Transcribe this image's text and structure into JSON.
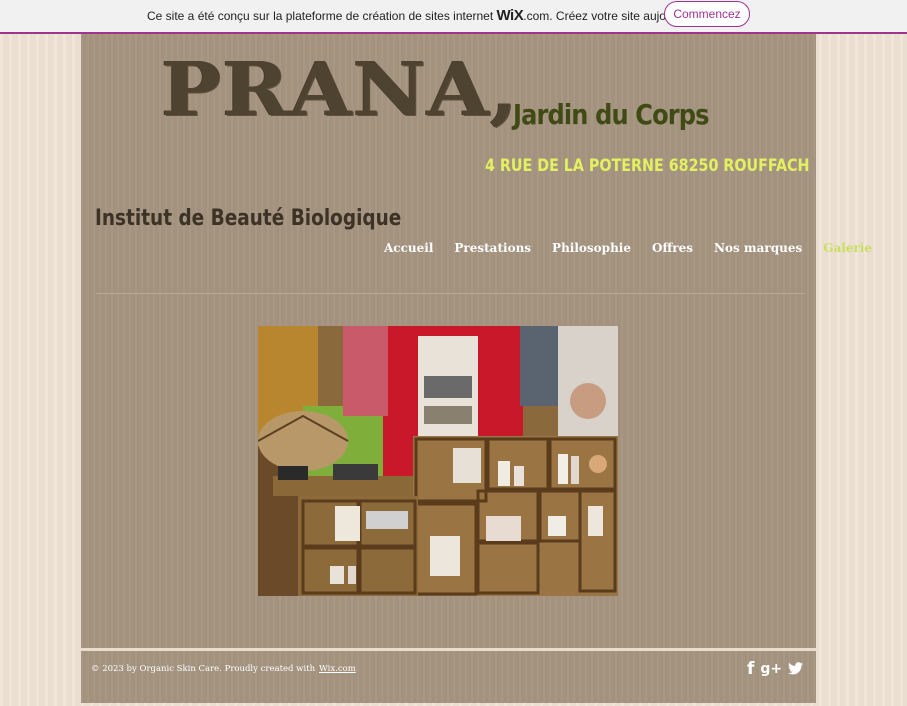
{
  "wix_banner": {
    "text_before": "Ce site a été conçu sur la plateforme de création de sites internet ",
    "logo": "WiX",
    "text_after": ".com. Créez votre site aujourd'hui.",
    "button_label": "Commencez",
    "accent_color": "#a1338f"
  },
  "header": {
    "logo_title": "PRANA,",
    "logo_subtitle": "Jardin du Corps",
    "address": "4 RUE DE LA POTERNE 68250 ROUFFACH",
    "tagline": "Institut de Beauté Biologique"
  },
  "nav": {
    "items": [
      {
        "label": "Accueil"
      },
      {
        "label": "Prestations"
      },
      {
        "label": "Philosophie"
      },
      {
        "label": "Offres"
      },
      {
        "label": "Nos marques"
      },
      {
        "label": "Galerie"
      }
    ],
    "active": "Galerie",
    "active_color": "#c8e05e"
  },
  "footer": {
    "copyright": "© 2023 by Organic Skin Care. Proudly created with",
    "link_label": "Wix.com",
    "social_icons": [
      "facebook-icon",
      "google-plus-icon",
      "twitter-icon"
    ],
    "facebook_glyph": "f",
    "google_glyph": "g+"
  }
}
